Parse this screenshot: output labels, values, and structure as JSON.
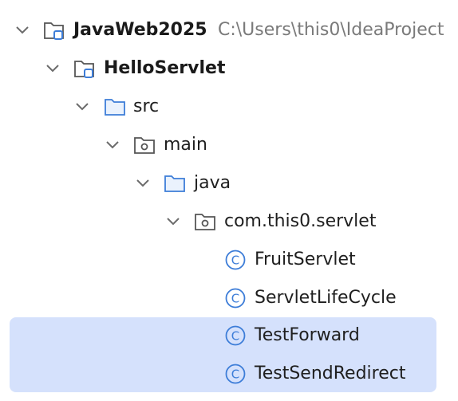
{
  "project_tree": {
    "root": {
      "name": "JavaWeb2025",
      "path": "C:\\Users\\this0\\IdeaProject",
      "icon": "project-module-folder-icon"
    },
    "items": [
      {
        "name": "HelloServlet",
        "icon": "module-folder-icon",
        "expanded": true
      },
      {
        "name": "src",
        "icon": "folder-icon",
        "expanded": true
      },
      {
        "name": "main",
        "icon": "package-folder-icon",
        "expanded": true
      },
      {
        "name": "java",
        "icon": "folder-icon",
        "expanded": true
      },
      {
        "name": "com.this0.servlet",
        "icon": "package-folder-icon",
        "expanded": true
      },
      {
        "name": "FruitServlet",
        "icon": "java-class-icon"
      },
      {
        "name": "ServletLifeCycle",
        "icon": "java-class-icon"
      },
      {
        "name": "TestForward",
        "icon": "java-class-icon",
        "selected": true
      },
      {
        "name": "TestSendRedirect",
        "icon": "java-class-icon",
        "selected": true
      }
    ]
  },
  "colors": {
    "selection": "#d5e1fc",
    "folder_stroke": "#5c6bc0",
    "folder_blue": "#3d7dd8",
    "class_icon": "#3d7dd8",
    "path_text": "#7a7a7a",
    "chevron": "#6b6b6b"
  }
}
